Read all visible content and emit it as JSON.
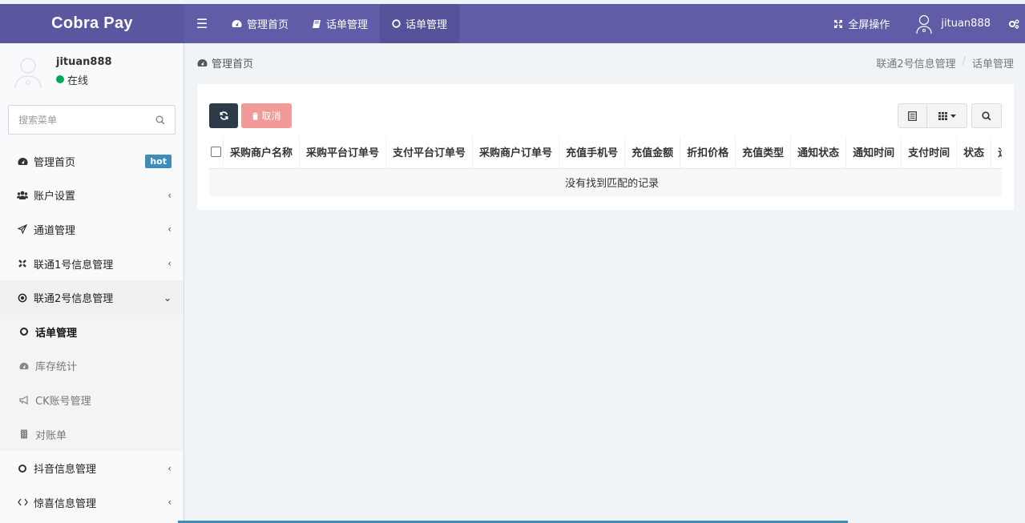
{
  "app": {
    "logo": "Cobra Pay"
  },
  "topbar": {
    "tabs": [
      {
        "icon": "dashboard-icon",
        "label": "管理首页"
      },
      {
        "icon": "book-icon",
        "label": "话单管理"
      },
      {
        "icon": "circle-icon",
        "label": "话单管理"
      }
    ],
    "fullscreen_label": "全屏操作",
    "username": "jituan888"
  },
  "sidebar": {
    "user": {
      "name": "jituan888",
      "status": "在线"
    },
    "search_placeholder": "搜索菜单",
    "items": [
      {
        "icon": "dashboard-icon",
        "label": "管理首页",
        "badge": "hot"
      },
      {
        "icon": "users-icon",
        "label": "账户设置",
        "arrow": "‹"
      },
      {
        "icon": "paper-plane-icon",
        "label": "通道管理",
        "arrow": "‹"
      },
      {
        "icon": "joomla-icon",
        "label": "联通1号信息管理",
        "arrow": "‹"
      },
      {
        "icon": "dot-circle-icon",
        "label": "联通2号信息管理",
        "arrow": "⌄"
      },
      {
        "icon": "circle-icon",
        "label": "抖音信息管理",
        "arrow": "‹"
      },
      {
        "icon": "code-icon",
        "label": "惊喜信息管理",
        "arrow": "‹"
      }
    ],
    "submenu": [
      {
        "icon": "circle-icon",
        "label": "话单管理"
      },
      {
        "icon": "dashboard-icon",
        "label": "库存统计"
      },
      {
        "icon": "bullhorn-icon",
        "label": "CK账号管理"
      },
      {
        "icon": "building-icon",
        "label": "对账单"
      }
    ]
  },
  "content": {
    "page_title": "管理首页",
    "breadcrumb": [
      "联通2号信息管理",
      "话单管理"
    ],
    "toolbar": {
      "cancel_label": "取消"
    },
    "table": {
      "columns": [
        "采购商户名称",
        "采购平台订单号",
        "支付平台订单号",
        "采购商户订单号",
        "充值手机号",
        "充值金额",
        "折扣价格",
        "充值类型",
        "通知状态",
        "通知时间",
        "支付时间",
        "状态",
        "运"
      ],
      "empty_text": "没有找到匹配的记录"
    }
  },
  "colors": {
    "topbar": "#605ca8",
    "hot_badge": "#3c8dbc",
    "online": "#00a65a",
    "cancel": "#f29a9a",
    "refresh": "#2c3b47"
  }
}
